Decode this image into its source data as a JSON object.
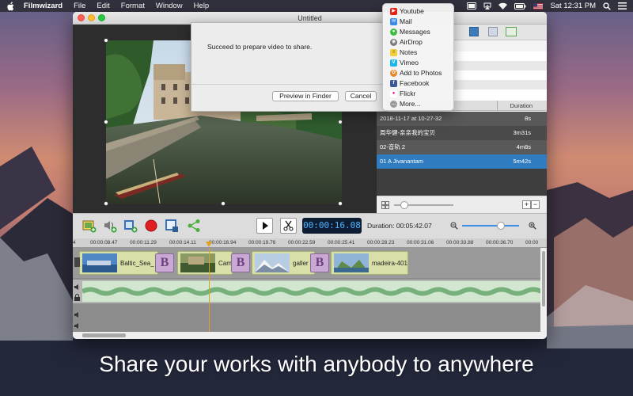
{
  "menubar": {
    "app_name": "Filmwizard",
    "menus": [
      "File",
      "Edit",
      "Format",
      "Window",
      "Help"
    ],
    "clock": "Sat 12:31 PM"
  },
  "window": {
    "title": "Untitled"
  },
  "dialog": {
    "message": "Succeed to prepare video to share.",
    "preview_button": "Preview in Finder",
    "cancel_button": "Cancel"
  },
  "share_menu": {
    "items": [
      {
        "label": "Youtube",
        "icon": "youtube-icon",
        "color": "#e62117"
      },
      {
        "label": "Mail",
        "icon": "mail-icon",
        "color": "#3d8ae6"
      },
      {
        "label": "Messages",
        "icon": "messages-icon",
        "color": "#3fbb40"
      },
      {
        "label": "AirDrop",
        "icon": "airdrop-icon",
        "color": "#7a7a7a"
      },
      {
        "label": "Notes",
        "icon": "notes-icon",
        "color": "#f3cf3a"
      },
      {
        "label": "Vimeo",
        "icon": "vimeo-icon",
        "color": "#1ab7ea"
      },
      {
        "label": "Add to Photos",
        "icon": "photos-icon",
        "color": "#e8872d"
      },
      {
        "label": "Facebook",
        "icon": "facebook-icon",
        "color": "#3b5998"
      },
      {
        "label": "Flickr",
        "icon": "flickr-icon",
        "color": "#ff0084"
      },
      {
        "label": "More...",
        "icon": "more-icon",
        "color": "#9a9a9a"
      }
    ]
  },
  "clip_list": {
    "duration_header": "Duration",
    "rows": [
      {
        "name": "2018-11-17 at 10-27-32",
        "duration": "8s"
      },
      {
        "name": "周华健-亲亲我的宝贝",
        "duration": "3m31s"
      },
      {
        "name": "02-音轨 2",
        "duration": "4m8s"
      },
      {
        "name": "01 A Jivanantam",
        "duration": "5m42s",
        "selected": true
      }
    ]
  },
  "toolbar": {
    "timecode": "00:00:16.08",
    "duration_text": "Duration: 00:05:42.07"
  },
  "ruler": {
    "ticks": [
      "4",
      "00:00:08.47",
      "00:00:11.29",
      "00:00:14.11",
      "00:00:16.94",
      "00:00:19.76",
      "00:00:22.59",
      "00:00:25.41",
      "00:00:28.23",
      "00:00:31.06",
      "00:00:33.88",
      "00:00:36.70",
      "00:00"
    ]
  },
  "timeline": {
    "clips": [
      {
        "label": "Baltic_Sea_"
      },
      {
        "label": "Cam"
      },
      {
        "label": "galler"
      },
      {
        "label": "madeira-401"
      }
    ],
    "transition_glyph": "B"
  },
  "caption": "Share your works with anybody to anywhere"
}
